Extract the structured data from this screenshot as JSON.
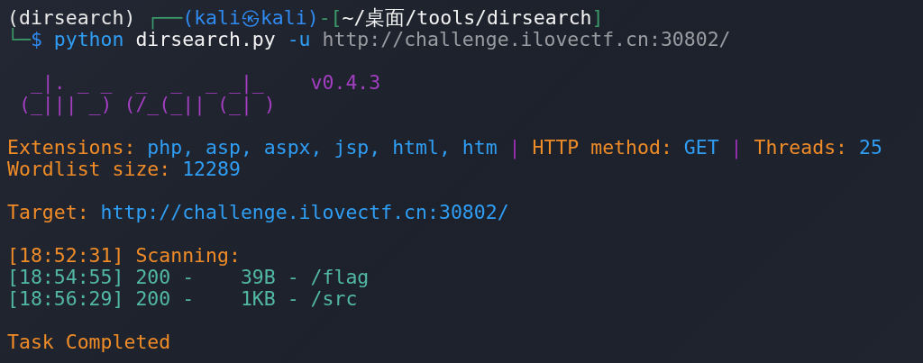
{
  "terminal": {
    "lines": [
      {
        "kind": "text",
        "segments": [
          {
            "text": "(dirsearch) ",
            "color": "#e8e8e8"
          },
          {
            "text": "┌──",
            "color": "#3c9a6a"
          },
          {
            "text": "(kali㉿kali)",
            "color": "#2f8bf0"
          },
          {
            "text": "-[",
            "color": "#3c9a6a"
          },
          {
            "text": "~/桌面/tools/dirsearch",
            "color": "#f2f2f2"
          },
          {
            "text": "]",
            "color": "#3c9a6a"
          }
        ]
      },
      {
        "kind": "text",
        "segments": [
          {
            "text": "└─",
            "color": "#3c9a6a"
          },
          {
            "text": "$ ",
            "color": "#2f8bf0"
          },
          {
            "text": "python",
            "color": "#2f9ef4"
          },
          {
            "text": " dirsearch.py",
            "color": "#f2f2f2"
          },
          {
            "text": " -u",
            "color": "#2f9ef4"
          },
          {
            "text": " http://challenge.ilovectf.cn:30802/",
            "color": "#9a9ca2"
          }
        ]
      },
      {
        "kind": "blank"
      },
      {
        "kind": "text",
        "segments": [
          {
            "text": "  _|. _ _  _  _  _ _|_",
            "color": "#a23fc0"
          },
          {
            "text": "    v0.4.3",
            "color": "#a23fc0"
          }
        ]
      },
      {
        "kind": "text",
        "segments": [
          {
            "text": " (_||| _) (/_(_|| (_| )",
            "color": "#a23fc0"
          }
        ]
      },
      {
        "kind": "blank"
      },
      {
        "kind": "text",
        "segments": [
          {
            "text": "Extensions: ",
            "color": "#f08c28"
          },
          {
            "text": "php, asp, aspx, jsp, html, htm",
            "color": "#2f9ef4"
          },
          {
            "text": " | ",
            "color": "#9c2fb8"
          },
          {
            "text": "HTTP method: ",
            "color": "#f08c28"
          },
          {
            "text": "GET",
            "color": "#2f9ef4"
          },
          {
            "text": " | ",
            "color": "#9c2fb8"
          },
          {
            "text": "Threads: ",
            "color": "#f08c28"
          },
          {
            "text": "25",
            "color": "#2f9ef4"
          }
        ]
      },
      {
        "kind": "text",
        "segments": [
          {
            "text": "Wordlist size: ",
            "color": "#f08c28"
          },
          {
            "text": "12289",
            "color": "#2f9ef4"
          }
        ]
      },
      {
        "kind": "blank"
      },
      {
        "kind": "text",
        "segments": [
          {
            "text": "Target: ",
            "color": "#f08c28"
          },
          {
            "text": "http://challenge.ilovectf.cn:30802/",
            "color": "#2f9ef4"
          }
        ]
      },
      {
        "kind": "blank"
      },
      {
        "kind": "text",
        "segments": [
          {
            "text": "[18:52:31] Scanning:",
            "color": "#f08c28"
          }
        ]
      },
      {
        "kind": "text",
        "segments": [
          {
            "text": "[18:54:55] 200 -    39B - /flag",
            "color": "#52b8a6"
          }
        ]
      },
      {
        "kind": "text",
        "segments": [
          {
            "text": "[18:56:29] 200 -    1KB - /src",
            "color": "#52b8a6"
          }
        ]
      },
      {
        "kind": "blank"
      },
      {
        "kind": "text",
        "segments": [
          {
            "text": "Task Completed",
            "color": "#f08c28"
          }
        ]
      }
    ]
  }
}
